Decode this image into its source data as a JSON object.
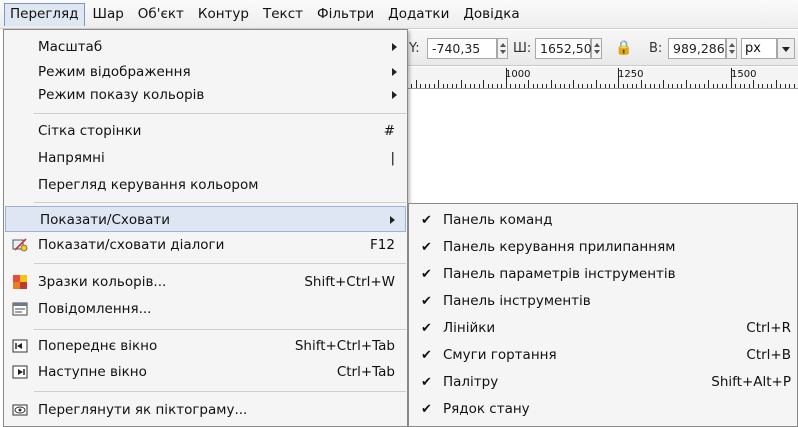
{
  "menubar": {
    "items": [
      "Перегляд",
      "Шар",
      "Об'єкт",
      "Контур",
      "Текст",
      "Фільтри",
      "Додатки",
      "Довідка"
    ]
  },
  "toolbar": {
    "y_label": "Y:",
    "y_value": "-740,35",
    "w_label": "Ш:",
    "w_value": "1652,50",
    "h_label": "В:",
    "h_value": "989,286",
    "unit": "px"
  },
  "ruler": {
    "labels": [
      "1000",
      "1250",
      "1500"
    ]
  },
  "view_menu": {
    "items": [
      {
        "label": "Масштаб"
      },
      {
        "label": "Режим відображення"
      },
      {
        "label": "Режим показу кольорів"
      },
      {
        "label": "Сітка сторінки",
        "shortcut": "#"
      },
      {
        "label": "Напрямні",
        "shortcut": "|"
      },
      {
        "label": "Перегляд керування кольором"
      },
      {
        "label": "Показати/Сховати"
      },
      {
        "label": "Показати/сховати діалоги",
        "shortcut": "F12"
      },
      {
        "label": "Зразки кольорів...",
        "shortcut": "Shift+Ctrl+W"
      },
      {
        "label": "Повідомлення..."
      },
      {
        "label": "Попереднє вікно",
        "shortcut": "Shift+Ctrl+Tab"
      },
      {
        "label": "Наступне вікно",
        "shortcut": "Ctrl+Tab"
      },
      {
        "label": "Переглянути як піктограму..."
      }
    ]
  },
  "show_hide_submenu": {
    "items": [
      {
        "label": "Панель команд",
        "shortcut": ""
      },
      {
        "label": "Панель керування прилипанням",
        "shortcut": ""
      },
      {
        "label": "Панель параметрів інструментів",
        "shortcut": ""
      },
      {
        "label": "Панель інструментів",
        "shortcut": ""
      },
      {
        "label": "Лінійки",
        "shortcut": "Ctrl+R"
      },
      {
        "label": "Смуги гортання",
        "shortcut": "Ctrl+B"
      },
      {
        "label": "Палітру",
        "shortcut": "Shift+Alt+P"
      },
      {
        "label": "Рядок стану",
        "shortcut": ""
      }
    ],
    "check_glyph": "✔"
  }
}
